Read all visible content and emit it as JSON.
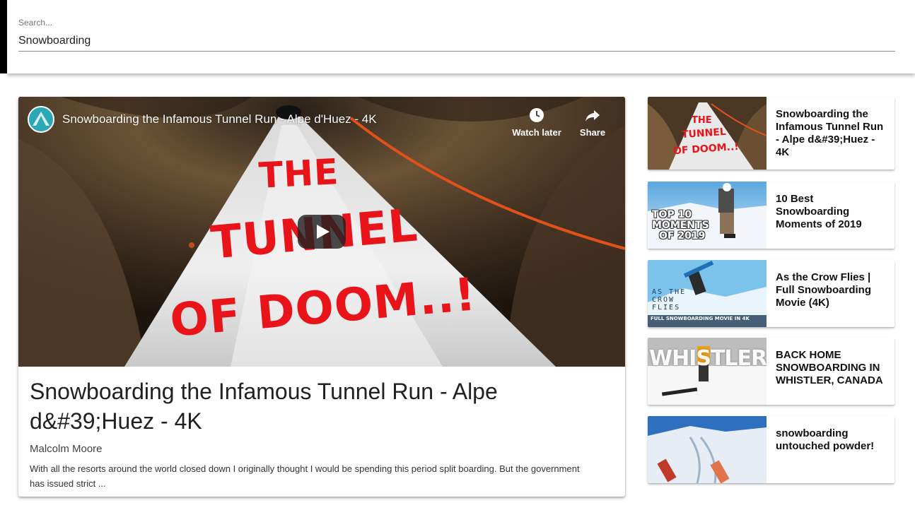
{
  "search": {
    "label": "Search...",
    "value": "Snowboarding"
  },
  "player": {
    "title": "Snowboarding the Infamous Tunnel Run - Alpe d'Huez - 4K",
    "watch_later_label": "Watch later",
    "share_label": "Share",
    "overlay_line1": "THE",
    "overlay_line2": "TUNNEL",
    "overlay_line3": "OF DOOM..!"
  },
  "main": {
    "title": "Snowboarding the Infamous Tunnel Run - Alpe d&#39;Huez - 4K",
    "channel": "Malcolm Moore",
    "description": "With all the resorts around the world closed down I originally thought I would be spending this period split boarding. But the government has issued strict ..."
  },
  "sidebar": {
    "items": [
      {
        "title": "Snowboarding the Infamous Tunnel Run - Alpe d&#39;Huez - 4K",
        "thumb_text": [
          "THE",
          "TUNNEL",
          "OF DOOM..!"
        ]
      },
      {
        "title": "10 Best Snowboarding Moments of 2019",
        "thumb_text": [
          "TOP 10",
          "MOMENTS",
          "OF 2019"
        ]
      },
      {
        "title": "As the Crow Flies | Full Snowboarding Movie (4K)",
        "thumb_text": [
          "AS THE",
          "CROW",
          "FLIES",
          "FULL SNOWBOARDING MOVIE IN 4K"
        ]
      },
      {
        "title": "BACK HOME SNOWBOARDING IN WHISTLER, CANADA",
        "thumb_text": [
          "WHISTLER"
        ]
      },
      {
        "title": "snowboarding untouched powder!",
        "thumb_text": []
      }
    ]
  },
  "colors": {
    "accent_red": "#e8141a",
    "card_bg": "#ffffff",
    "text_primary": "#212121"
  }
}
